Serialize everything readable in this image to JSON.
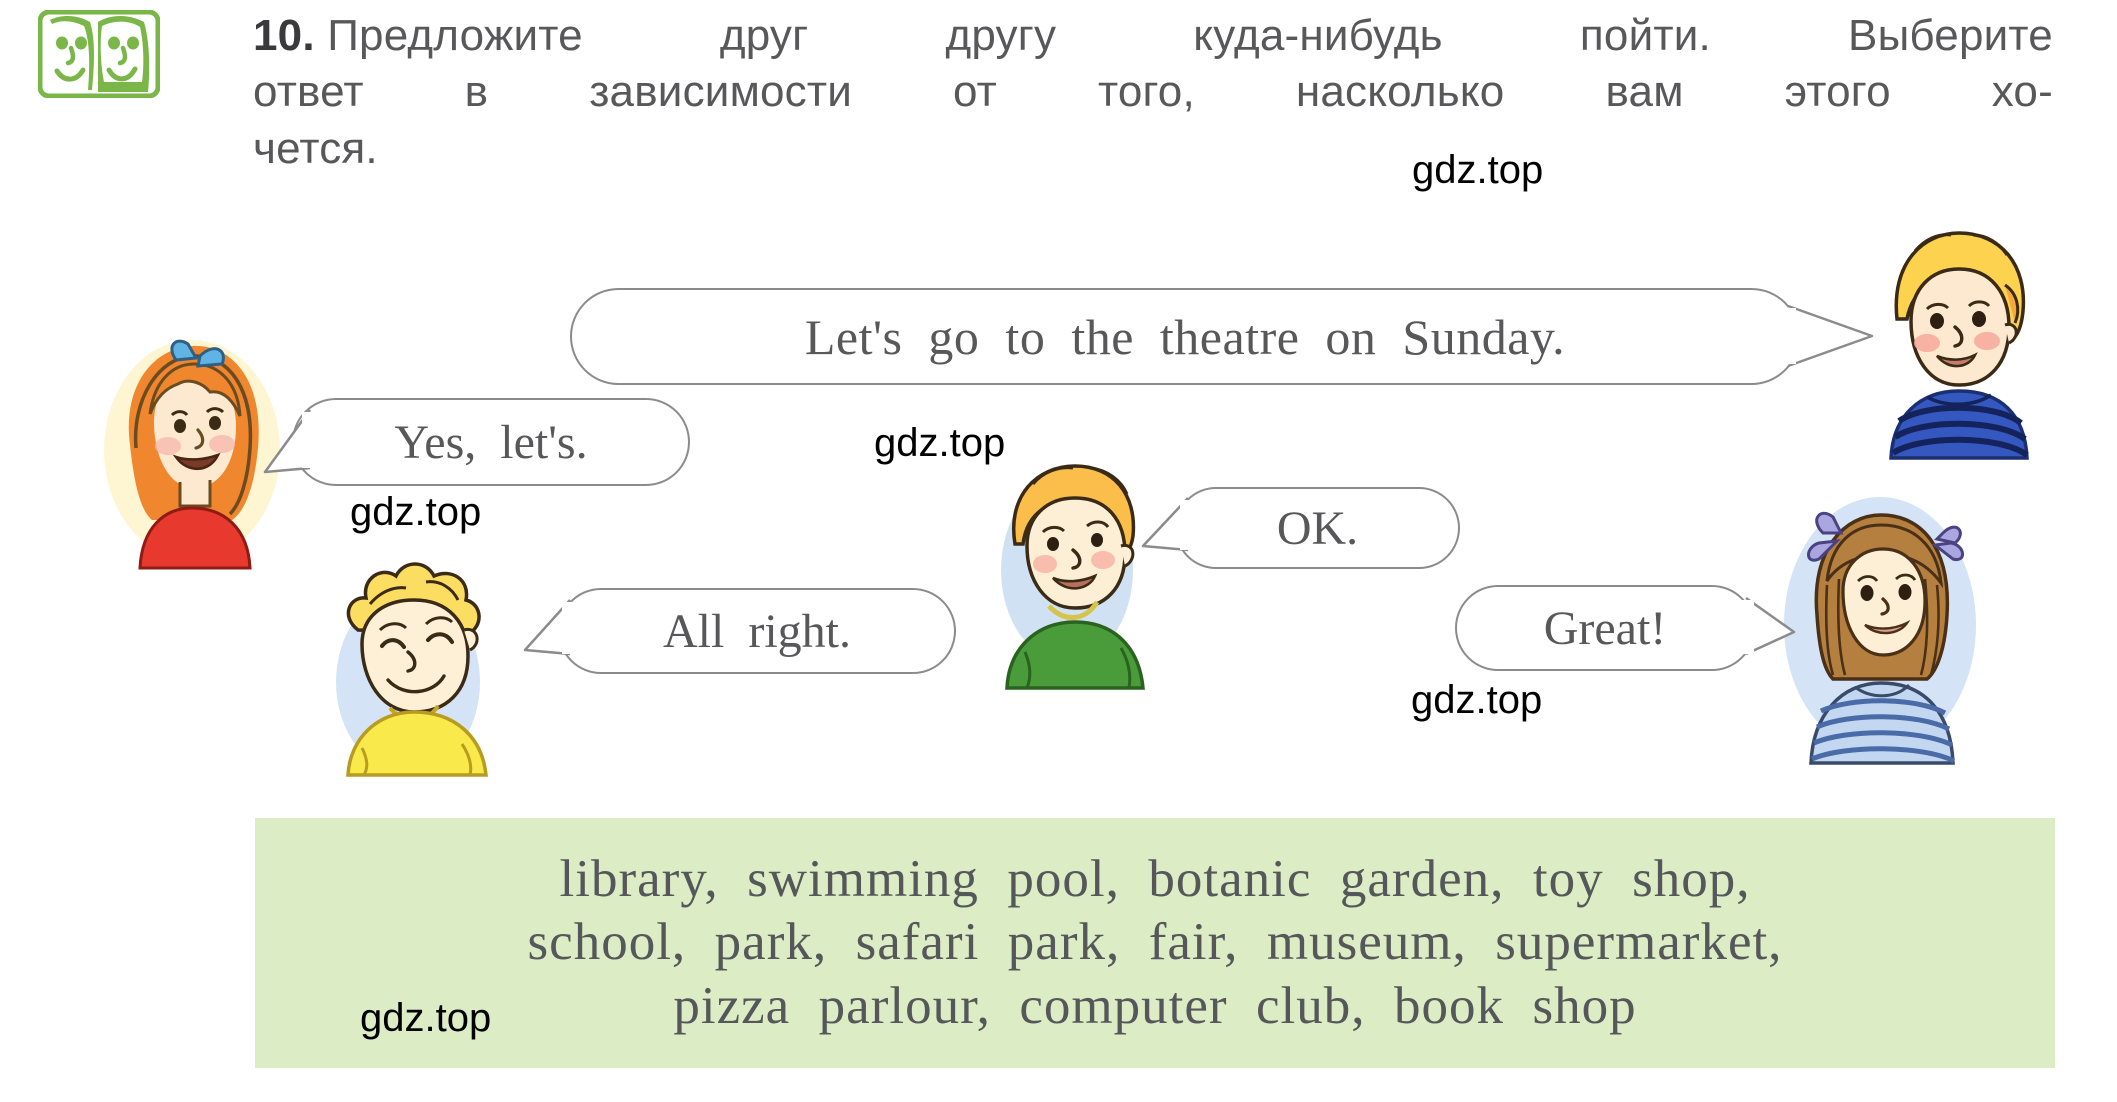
{
  "exercise": {
    "number": "10.",
    "icon_name": "two-faces-pair-work-icon",
    "instruction_line1_a": "Предложите",
    "instruction_line1_b": "друг",
    "instruction_line1_c": "другу",
    "instruction_line1_d": "куда-нибудь",
    "instruction_line1_e": "пойти.",
    "instruction_line1_f": "Выберите",
    "instruction_line2_a": "ответ",
    "instruction_line2_b": "в",
    "instruction_line2_c": "зависимости",
    "instruction_line2_d": "от",
    "instruction_line2_e": "того,",
    "instruction_line2_f": "насколько",
    "instruction_line2_g": "вам",
    "instruction_line2_h": "этого",
    "instruction_line2_i": "хо-",
    "instruction_line3": "чется."
  },
  "dialogue": {
    "prompt": "Let's  go  to  the  theatre  on  Sunday.",
    "replies": [
      {
        "text": "Yes,  let's.",
        "speaker": "girl-red-shirt"
      },
      {
        "text": "All  right.",
        "speaker": "boy-yellow-shirt"
      },
      {
        "text": "OK.",
        "speaker": "boy-green-shirt"
      },
      {
        "text": "Great!",
        "speaker": "girl-striped-shirt"
      }
    ]
  },
  "word_bank": {
    "background_color": "#dcecc4",
    "line1": "library,  swimming  pool,  botanic  garden,  toy  shop,",
    "line2": "school,  park,  safari  park,  fair,  museum,  supermarket,",
    "line3": "pizza  parlour,  computer  club,  book  shop",
    "words": [
      "library",
      "swimming pool",
      "botanic garden",
      "toy shop",
      "school",
      "park",
      "safari park",
      "fair",
      "museum",
      "supermarket",
      "pizza parlour",
      "computer club",
      "book shop"
    ]
  },
  "watermarks": {
    "text": "gdz.top",
    "count": 5
  },
  "characters": [
    {
      "name": "girl-red-shirt",
      "hair": "#f07d2a",
      "shirt": "#e8392f",
      "accessory": "blue-bow"
    },
    {
      "name": "boy-blue-striped-sweater",
      "hair": "#fbd25a",
      "shirt": "#2f54b8",
      "accessory": "stripes"
    },
    {
      "name": "boy-yellow-shirt",
      "hair": "#fbdd62",
      "shirt": "#f9e94a",
      "accessory": "none"
    },
    {
      "name": "boy-green-shirt",
      "hair": "#fbbe4a",
      "shirt": "#4a9b3a",
      "accessory": "none"
    },
    {
      "name": "girl-striped-shirt",
      "hair": "#b5803f",
      "shirt": "#a9c6e8",
      "accessory": "purple-bows"
    }
  ],
  "colors": {
    "text_gray": "#58585a",
    "bubble_border": "#8b8b8d",
    "icon_green": "#7ab648",
    "word_box_green": "#dcecc4"
  }
}
